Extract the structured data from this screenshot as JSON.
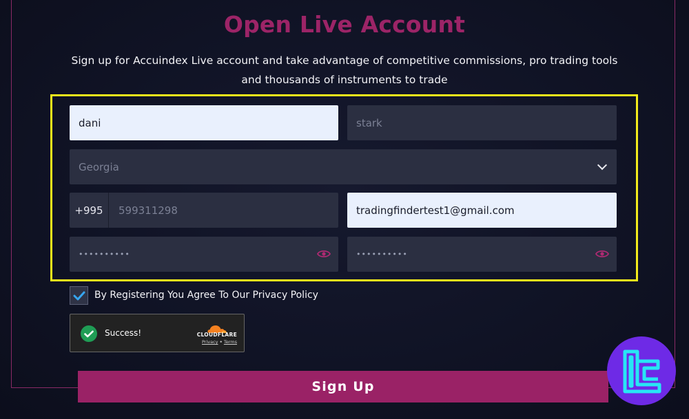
{
  "page": {
    "title": "Open Live Account",
    "subtitle_line1": "Sign up for Accuindex Live account and take advantage of competitive commissions, pro trading tools",
    "subtitle_line2": "and thousands of instruments to trade"
  },
  "form": {
    "first_name": {
      "value": "dani"
    },
    "last_name": {
      "placeholder": "stark"
    },
    "country": {
      "selected": "Georgia"
    },
    "phone": {
      "code": "+995",
      "placeholder": "599311298"
    },
    "email": {
      "value": "tradingfindertest1@gmail.com"
    },
    "password": {
      "masked": "••••••••••"
    },
    "confirm_password": {
      "masked": "••••••••••"
    },
    "agree_label": "By Registering You Agree To Our Privacy Policy",
    "agree_checked": true
  },
  "captcha": {
    "status": "Success!",
    "brand": "CLOUDFLARE",
    "privacy_link": "Privacy",
    "separator": "•",
    "terms_link": "Terms"
  },
  "signup_button": "Sign Up",
  "colors": {
    "accent": "#9a2266",
    "highlight": "#f4ec1b",
    "field_bg": "#2b2f41",
    "filled_bg": "#e9f0fd",
    "badge": "#6e2ae6",
    "badge_logo": "#27e6f5"
  },
  "icons": {
    "select_arrow": "chevron-down-icon",
    "password_toggle": "eye-icon",
    "checkbox": "checkmark-icon",
    "captcha_ok": "check-circle-icon",
    "captcha_brand": "cloud-icon",
    "watermark": "tradingfinder-logo"
  }
}
